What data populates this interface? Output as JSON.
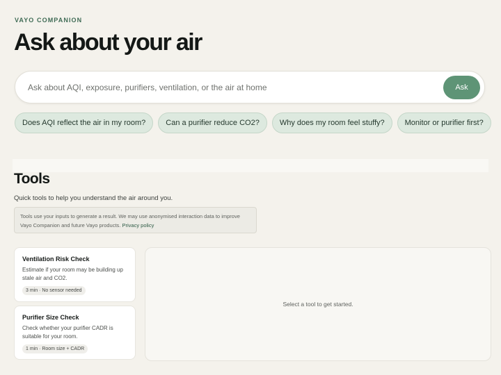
{
  "header": {
    "eyebrow": "VAYO COMPANION",
    "title": "Ask about your air"
  },
  "search": {
    "placeholder": "Ask about AQI, exposure, purifiers, ventilation, or the air at home",
    "value": "",
    "ask_label": "Ask"
  },
  "suggestions": [
    "Does AQI reflect the air in my room?",
    "Can a purifier reduce CO2?",
    "Why does my room feel stuffy?",
    "Monitor or purifier first?"
  ],
  "tools": {
    "heading": "Tools",
    "subtitle": "Quick tools to help you understand the air around you.",
    "notice_text": "Tools use your inputs to generate a result. We may use anonymised interaction data to improve Vayo Companion and future Vayo products.",
    "privacy_link": "Privacy policy",
    "cards": [
      {
        "title": "Ventilation Risk Check",
        "description": "Estimate if your room may be building up stale air and CO2.",
        "meta": "3 min · No sensor needed"
      },
      {
        "title": "Purifier Size Check",
        "description": "Check whether your purifier CADR is suitable for your room.",
        "meta": "1 min · Room size + CADR"
      }
    ],
    "empty_state": "Select a tool to get started."
  },
  "colors": {
    "background": "#f4f2ec",
    "accent": "#5e9476",
    "chip_background": "#dde9df",
    "eyebrow": "#3f6b55"
  }
}
